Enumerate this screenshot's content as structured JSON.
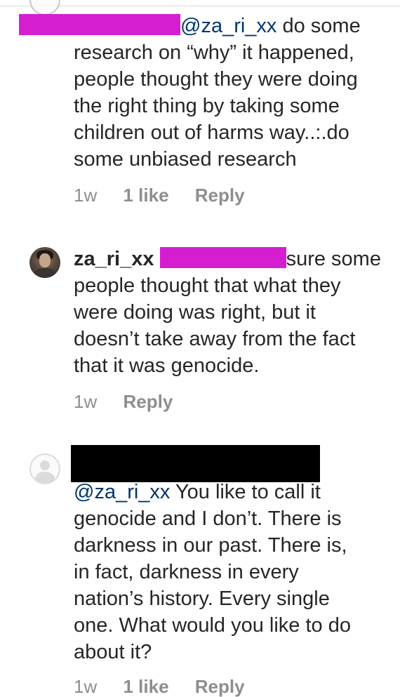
{
  "comments": [
    {
      "mention": "@za_ri_xx",
      "first_line": " do some",
      "body": "research on “why” it happened,\npeople thought they were doing\nthe right thing by taking some\nchildren out of harms way..:.do\nsome unbiased research",
      "time": "1w",
      "likes": "1 like",
      "reply": "Reply"
    },
    {
      "username": "za_ri_xx",
      "first_line": "sure some",
      "body": "people thought that what they\nwere doing was right, but it\ndoesn’t take away from the fact\nthat it was genocide.",
      "time": "1w",
      "reply": "Reply"
    },
    {
      "mention": "@za_ri_xx",
      "first_line": " You like to call it",
      "body": "genocide and I don’t. There is\ndarkness in our past. There is,\nin fact, darkness in every\nnation’s history. Every single\none. What would you like to do\nabout it?",
      "time": "1w",
      "likes": "1 like",
      "reply": "Reply"
    }
  ],
  "icons": {
    "avatar_2": "user-photo-avatar",
    "avatar_3": "default-profile-icon"
  },
  "colors": {
    "text": "#262626",
    "mention": "#00376b",
    "meta": "#8e8e8e",
    "redaction_magenta": "#d41ed0",
    "redaction_black": "#000000"
  }
}
